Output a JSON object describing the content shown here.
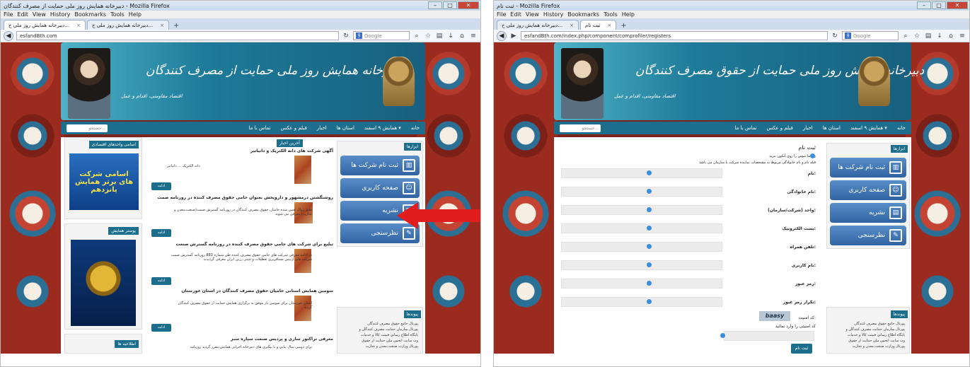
{
  "left": {
    "title": "دبیرخانه همایش روز ملی حمایت از مصرف کنندگان - Mozilla Firefox",
    "menu": [
      "File",
      "Edit",
      "View",
      "History",
      "Bookmarks",
      "Tools",
      "Help"
    ],
    "tabs": [
      {
        "label": "دبیرخانه همایش روز ملی ح..."
      },
      {
        "label": "دبیرخانه همایش روز ملی ح..."
      }
    ],
    "url": "esfandBth.com",
    "search_placeholder": "Google",
    "header_title": "دبیرخانه همایش روز ملی حمایت از مصرف کنندگان",
    "header_slogan": "اقتصاد مقاومتی، اقدام و عمل",
    "nav": [
      "خانه",
      "همایش ۹ اسفند",
      "استان ها",
      "اخبار",
      "فیلم و عکس",
      "تماس با ما"
    ],
    "site_search": "جستجو...",
    "tools_title": "ابزارها",
    "tools": [
      "ثبت نام شرکت ها",
      "صفحه کاربری",
      "نشریه",
      "نظرسنجی"
    ],
    "links_title": "پیوندها",
    "links": [
      "پورتال جامع حقوق مصرف کنندگان",
      "پورتال سازمان حمایت مصرف کنندگان و",
      "تولیدکنندگان",
      "پایگاه اطلاع رسانی قیمت کالا و خدمات",
      "وب سایت انجمن ملی حمایت از حقوق",
      "مصرف کنندگان",
      "پورتال وزارت صنعت،معدن و تجارت",
      "وب سایت جشنواره حامیان حقوق مصرف",
      "کنندگان استان فارس",
      "لینک وب سایت شرکت های برتر"
    ],
    "news_title": "آخرین اخبار",
    "news": [
      {
        "title": "آگهی شرکت های دانه الکتریک و دانیاتیر",
        "body": "دانه الکتریک ... دانیاتیر"
      },
      {
        "title": "روشنگشتن درمشهور و داروپخش بعنوان حامی حقوق مصرف کننده در روزنامه صمت",
        "body": "طبق روال تعیین شده حامیان حقوق مصرف کنندگان در روزنامه گسترش صمت(صنعت،معدن و تجارت) معرفی می شوند"
      },
      {
        "title": "تبلیغ برای شرکت های حامی حقوق مصرف کننده در روزنامه گسترش صنعت",
        "body": "در ادامه معرفی شرکت های حامی حقوق مصرف کننده طی شماره 883 روزنامه گسترش صمت شرکت های آرتیس مسافربری تعطیلات و چینی زرین ایران معرفی گردیدند"
      },
      {
        "title": "سومین همایش استانی حامیان حقوق مصرف کنندگان در استان خوزستان",
        "body": "استان خوزستان برای سومین بار موفق به برگزاری همایش حمایت از حقوق مصرف کنندگان گردید"
      },
      {
        "title": "معرفی تراکتور سازی و پردیس صنعت سپاره سبز",
        "body": "برای دومین سال پیاپی و با پیگیری های دبیرخانه اجرایی همایش،مقرر گردید روزنامه"
      }
    ],
    "more_label": "ادامه",
    "sidebar_box1": "اسامی واحدهای اقتصادی",
    "promo_text": "اسامی شرکت های برتر همایش پانزدهم",
    "sidebar_box2": "پوستر همایش",
    "sidebar_box3": "اطلاعیه ها"
  },
  "right": {
    "title": "ثبت نام - Mozilla Firefox",
    "menu": [
      "File",
      "Edit",
      "View",
      "History",
      "Bookmarks",
      "Tools",
      "Help"
    ],
    "tabs": [
      {
        "label": "ثبت نام"
      },
      {
        "label": "دبیرخانه همایش روز ملی ح..."
      }
    ],
    "url": "esfandBth.com/index.php/component/comprofiler/registers",
    "search_placeholder": "Google",
    "header_title": "دبیرخانه همایش روز ملی حمایت از حقوق مصرف کنندگان",
    "header_slogan": "اقتصاد مقاومتی، اقدام و عمل",
    "nav": [
      "خانه",
      "همایش ۹ اسفند",
      "استان ها",
      "اخبار",
      "فیلم و عکس",
      "تماس با ما"
    ],
    "site_search": "جستجو...",
    "form_title": "ثبت نام",
    "hint1": "راهنما:موس را روی آیکون ببرید",
    "hint2": "فیلد نام و نام خانوادگی مربوط به مشخصات نماینده شرکت یا سازمان می باشد",
    "fields": [
      "نام:",
      "نام خانوادگی:",
      "واحد (شرکت/سازمان):",
      "پست الکترونیک:",
      "تلفن همراه:",
      "نام کاربری:",
      "رمز عبور:",
      "تکرار رمز عبور:"
    ],
    "captcha_label": "کد امنیت:",
    "captcha_text": "baasy",
    "captcha_enter": "کد امنیتی را وارد نمائید",
    "register_button": "ثبت نام",
    "tools_title": "ابزارها",
    "tools": [
      "ثبت نام شرکت ها",
      "صفحه کاربری",
      "نشریه",
      "نظرسنجی"
    ],
    "links_title": "پیوندها",
    "links": [
      "پورتال جامع حقوق مصرف کنندگان",
      "پورتال سازمان حمایت مصرف کنندگان و",
      "تولیدکنندگان",
      "پایگاه اطلاع رسانی قیمت کالا و خدمات",
      "وب سایت انجمن ملی حمایت از حقوق",
      "مصرف کنندگان",
      "پورتال وزارت صنعت،معدن و تجارت",
      "وب سایت جشنواره حامیان حقوق مصرف",
      "کنندگان استان فارس",
      "لینک وب سایت شرکت های برتر"
    ]
  }
}
